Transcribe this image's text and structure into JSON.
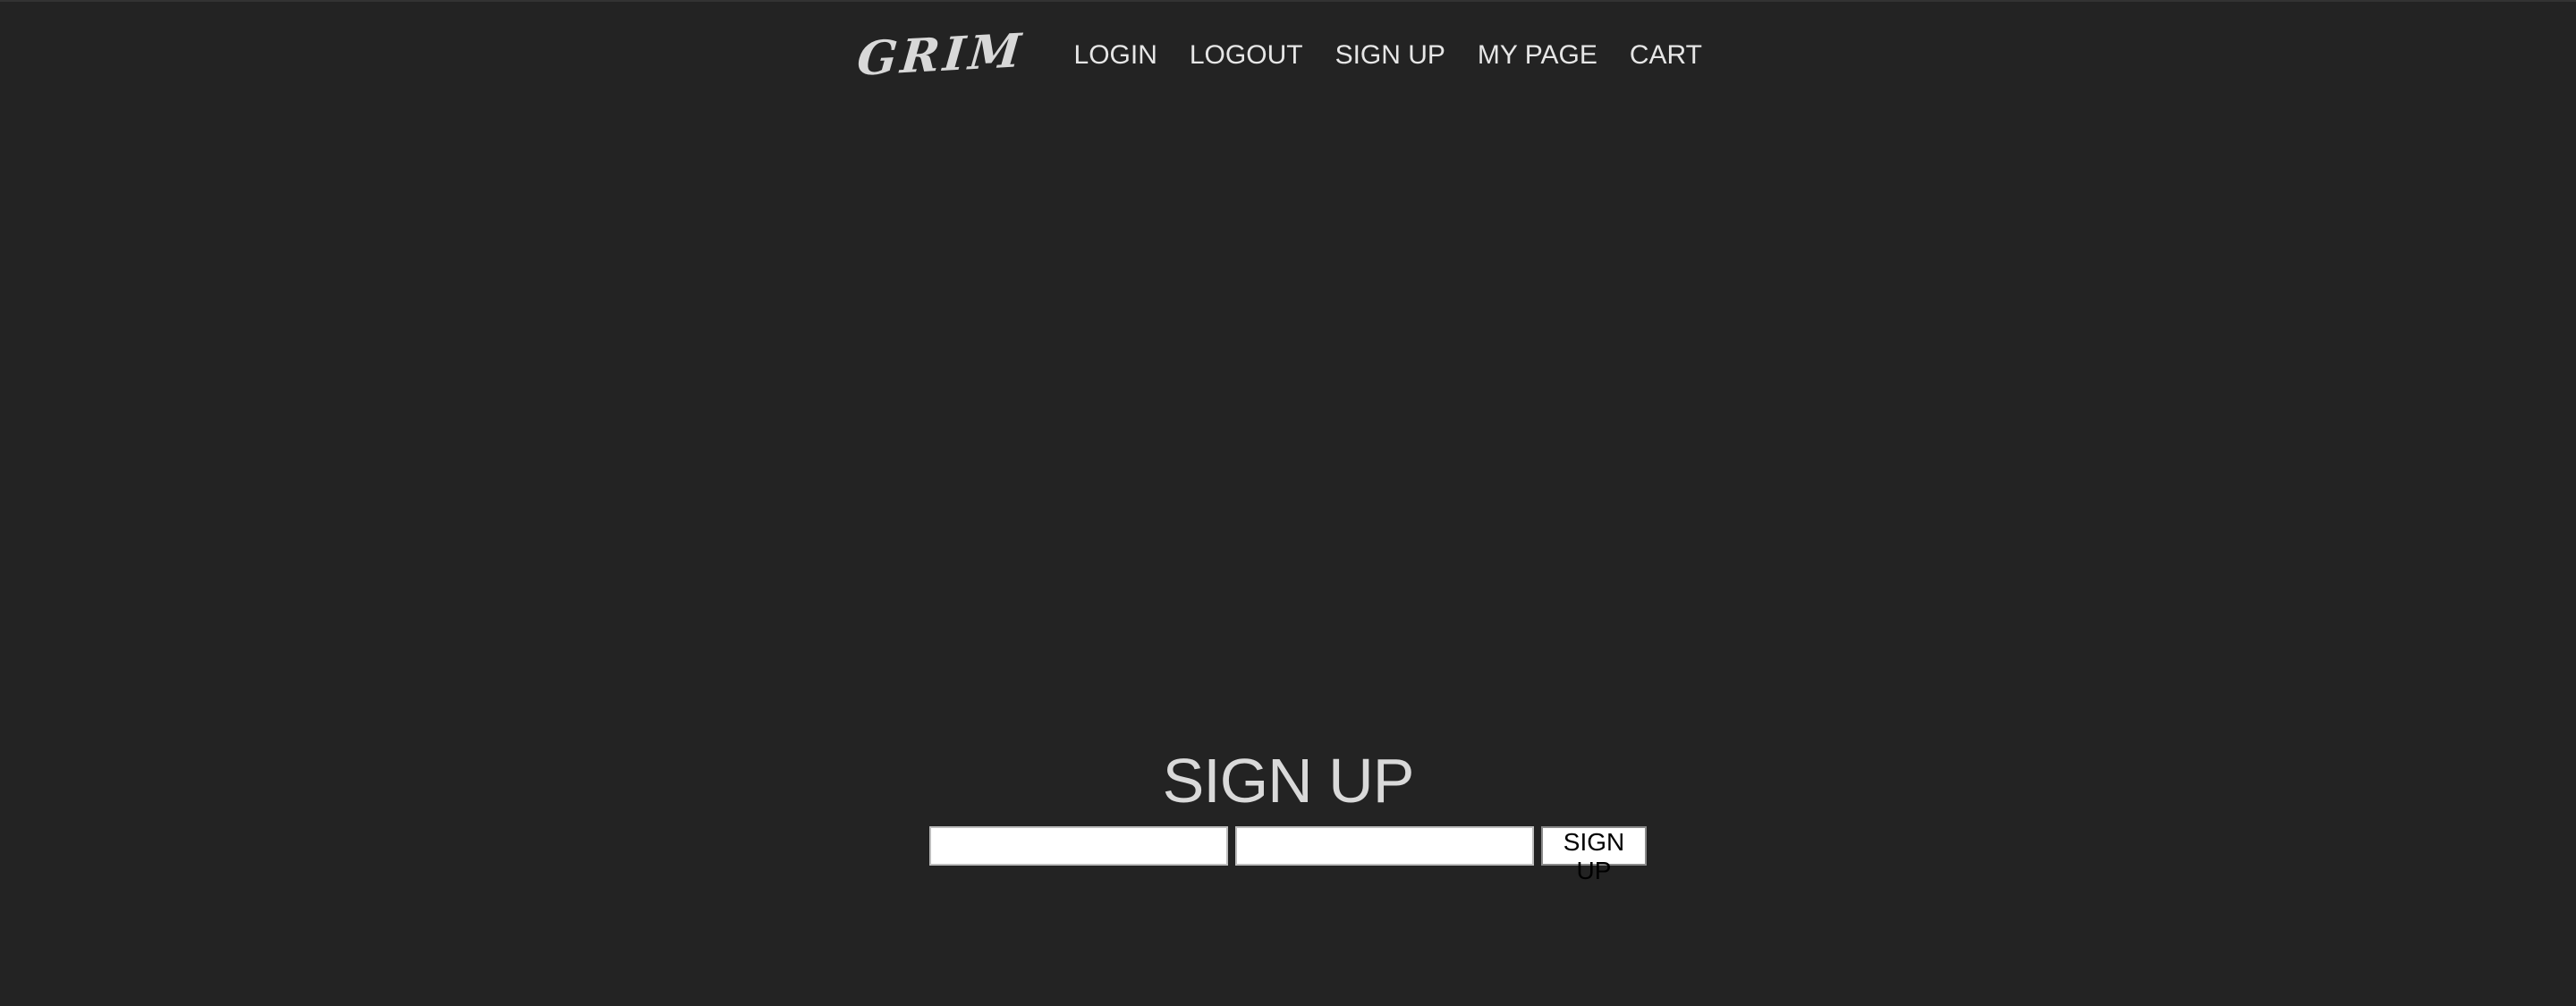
{
  "header": {
    "logo": "GRIM",
    "nav": [
      {
        "label": "LOGIN"
      },
      {
        "label": "LOGOUT"
      },
      {
        "label": "SIGN UP"
      },
      {
        "label": "MY PAGE"
      },
      {
        "label": "CART"
      }
    ]
  },
  "signup": {
    "title": "SIGN UP",
    "field1": {
      "value": "",
      "placeholder": ""
    },
    "field2": {
      "value": "",
      "placeholder": ""
    },
    "button_label": "SIGN UP"
  },
  "colors": {
    "background": "#232323",
    "text": "#e0e0e0",
    "input_background": "#ffffff"
  }
}
